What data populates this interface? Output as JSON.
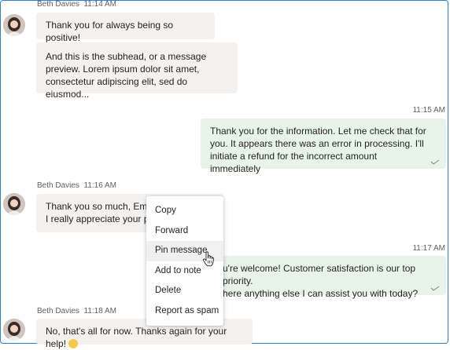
{
  "messages": [
    {
      "sender": "Beth Davies",
      "time": "11:14 AM",
      "bubbles": [
        "Thank you for always being so positive!",
        "And this is the subhead, or a message preview. Lorem ipsum dolor sit amet, consectetur adipiscing elit, sed do eiusmod..."
      ]
    },
    {
      "time": "11:15 AM",
      "text": "Thank you for the information. Let me check that for you. It appears there was an error in processing. I'll initiate a refund for the incorrect amount immediately"
    },
    {
      "sender": "Beth Davies",
      "time": "11:16 AM",
      "text_line1": "Thank you so much, Emily",
      "text_line2": "I really appreciate your pr"
    },
    {
      "time": "11:17 AM",
      "text_line1": "u're welcome! Customer satisfaction is our top priority.",
      "text_line2": "here anything else I can assist you with today?"
    },
    {
      "sender": "Beth Davies",
      "time": "11:18 AM",
      "text": "No, that's all for now. Thanks again for your help!",
      "emoji": "smile-emoji"
    }
  ],
  "context_menu": {
    "items": [
      "Copy",
      "Forward",
      "Pin message",
      "Add to note",
      "Delete",
      "Report as spam"
    ],
    "hovered": "Pin message"
  },
  "icons": {
    "avatar": "avatar-photo",
    "read_receipt": "check-icon",
    "cursor": "hand-cursor-icon"
  },
  "colors": {
    "incoming_bubble": "#f3f2f1",
    "outgoing_bubble": "#e8f4ea",
    "frame_border": "#2b7fd4",
    "menu_hover": "#f0f0f0"
  }
}
